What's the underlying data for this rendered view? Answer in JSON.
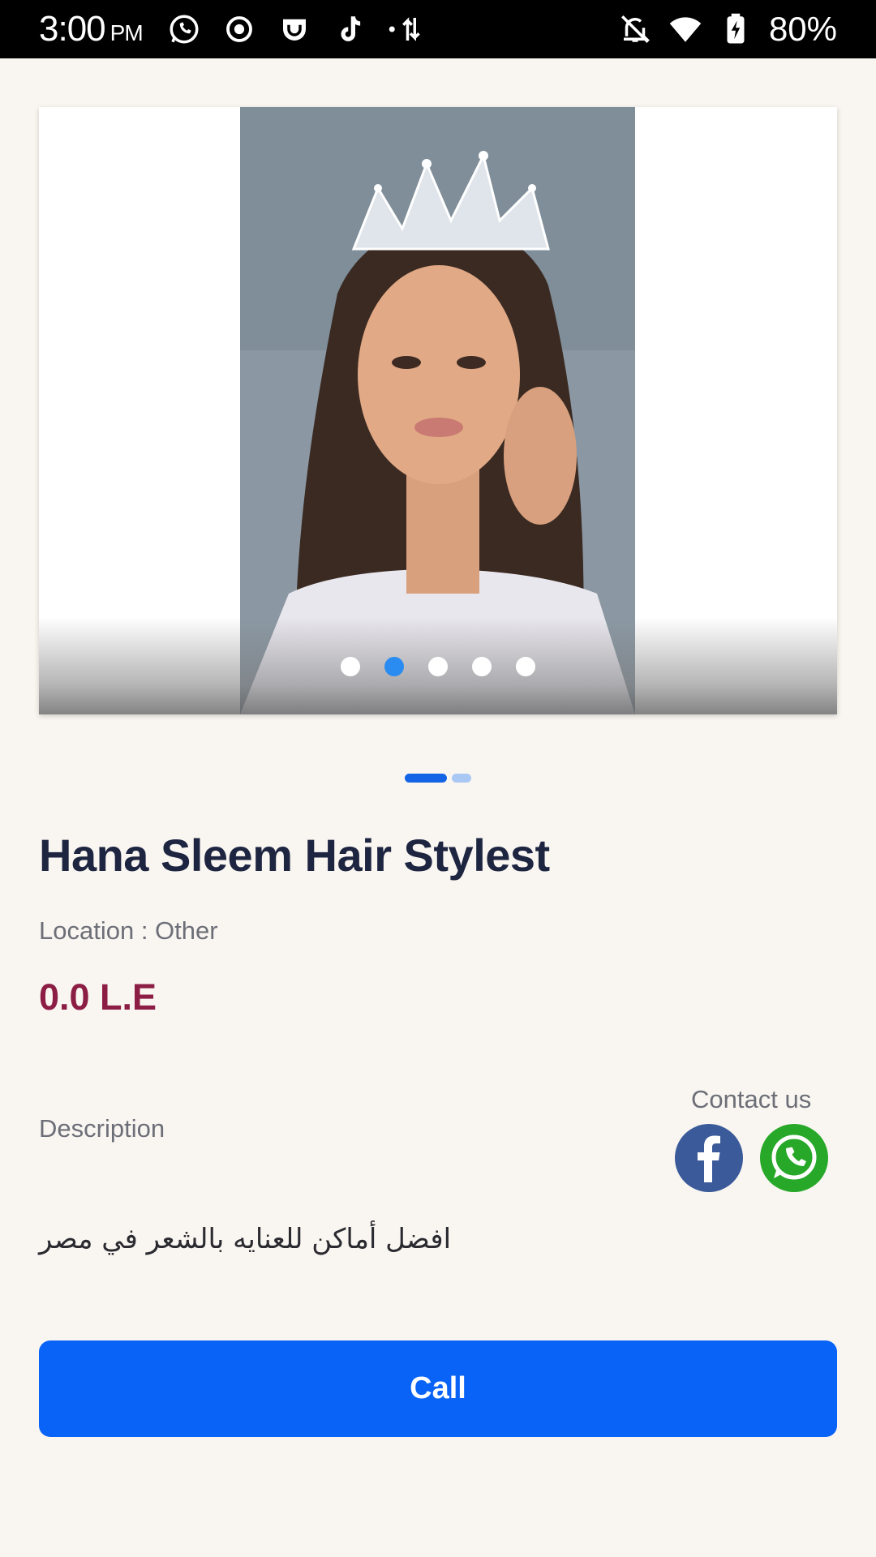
{
  "status_bar": {
    "time": "3:00",
    "ampm": "PM",
    "battery": "80%",
    "left_icons": [
      "whatsapp-icon",
      "record-icon",
      "app-icon",
      "tiktok-icon",
      "data-transfer-icon"
    ],
    "right_icons": [
      "silent-icon",
      "wifi-icon",
      "battery-charging-icon"
    ]
  },
  "carousel": {
    "image": "bridal-hair-stylist-photo",
    "dots_count": 5,
    "active_dot": 2
  },
  "page_indicator": {
    "count": 2,
    "active": 1
  },
  "listing": {
    "title": "Hana Sleem Hair Stylest",
    "location": "Location : Other",
    "price": "0.0 L.E",
    "description_label": "Description",
    "description": "افضل أماكن للعنايه بالشعر في مصر"
  },
  "contact": {
    "label": "Contact us",
    "facebook_icon": "facebook-icon",
    "whatsapp_icon": "whatsapp-icon"
  },
  "actions": {
    "call_label": "Call"
  },
  "colors": {
    "background": "#f9f6f1",
    "title": "#1e2541",
    "price": "#8c1d44",
    "call_button": "#0a63f7",
    "facebook": "#3b5a9a",
    "whatsapp": "#28a829",
    "active_dot": "#2a8cf0"
  }
}
